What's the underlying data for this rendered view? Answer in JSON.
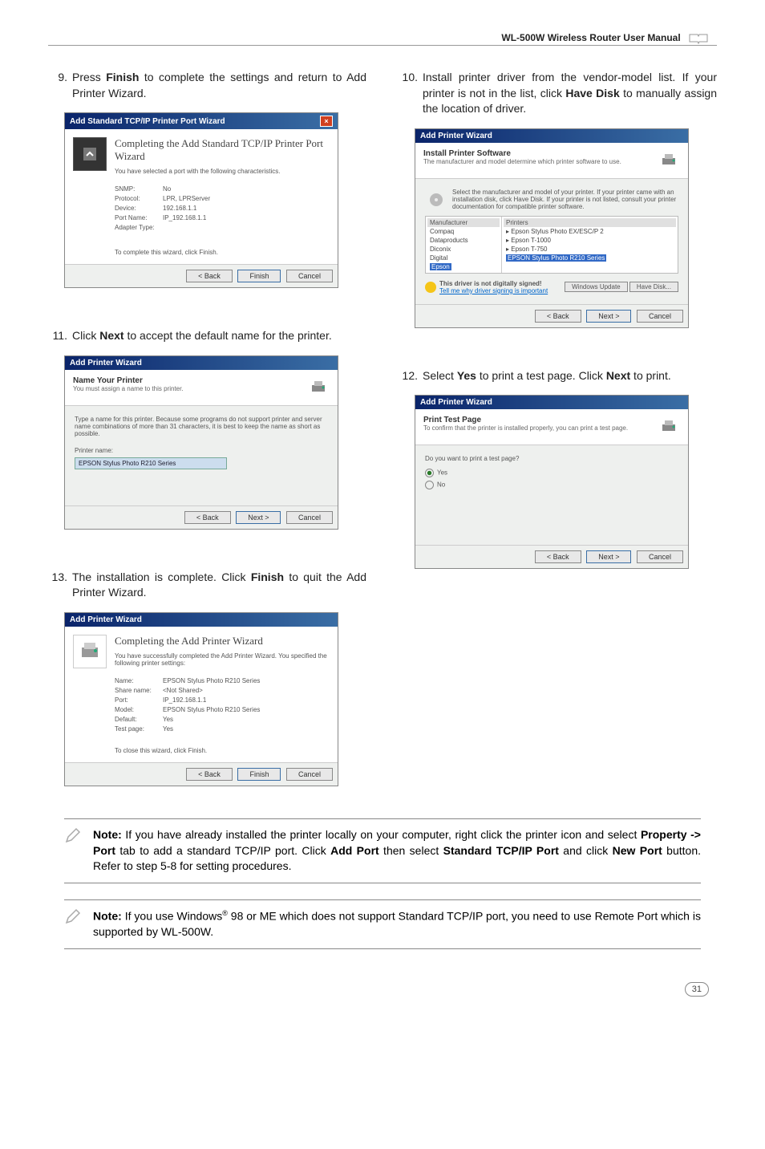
{
  "header": {
    "title": "WL-500W Wireless Router User Manual"
  },
  "steps": {
    "s9": {
      "num": "9.",
      "text_before": "Press ",
      "bold1": "Finish",
      "text_after": " to complete the settings and return to Add Printer Wizard."
    },
    "s10": {
      "num": "10.",
      "text_before": "Install printer driver from the vendor-model list. If your printer is not in the list, click ",
      "bold1": "Have Disk",
      "text_after": " to manually assign the location of driver."
    },
    "s11": {
      "num": "11.",
      "text_before": "Click ",
      "bold1": "Next",
      "text_after": " to accept the default name for the printer."
    },
    "s12": {
      "num": "12.",
      "text_before": "Select ",
      "bold1": "Yes",
      "text_mid": " to print a test page. Click ",
      "bold2": "Next",
      "text_after": " to print."
    },
    "s13": {
      "num": "13.",
      "text_before": "The installation is complete. Click ",
      "bold1": "Finish",
      "text_after": " to quit the Add Printer Wizard."
    }
  },
  "dialog9": {
    "title": "Add Standard TCP/IP Printer Port Wizard",
    "heading": "Completing the Add Standard TCP/IP Printer Port Wizard",
    "sub": "You have selected a port with the following characteristics.",
    "rows": {
      "snmp_l": "SNMP:",
      "snmp_v": "No",
      "proto_l": "Protocol:",
      "proto_v": "LPR, LPRServer",
      "dev_l": "Device:",
      "dev_v": "192.168.1.1",
      "port_l": "Port Name:",
      "port_v": "IP_192.168.1.1",
      "adapter_l": "Adapter Type:"
    },
    "footer_note": "To complete this wizard, click Finish.",
    "buttons": {
      "back": "< Back",
      "finish": "Finish",
      "cancel": "Cancel"
    }
  },
  "dialog10": {
    "title": "Add Printer Wizard",
    "heading": "Install Printer Software",
    "sub": "The manufacturer and model determine which printer software to use.",
    "instr": "Select the manufacturer and model of your printer. If your printer came with an installation disk, click Have Disk. If your printer is not listed, consult your printer documentation for compatible printer software.",
    "manu_hdr": "Manufacturer",
    "manu_items": [
      "Compaq",
      "Dataproducts",
      "Diconix",
      "Digital",
      "Epson"
    ],
    "printers_hdr": "Printers",
    "printers_items": [
      "Epson Stylus Photo EX/ESC/P 2",
      "Epson T-1000",
      "Epson T-750",
      "EPSON Stylus Photo R210 Series"
    ],
    "sig_text": "This driver is not digitally signed!",
    "sig_link": "Tell me why driver signing is important",
    "buttons": {
      "wu": "Windows Update",
      "hd": "Have Disk...",
      "back": "< Back",
      "next": "Next >",
      "cancel": "Cancel"
    }
  },
  "dialog11": {
    "title": "Add Printer Wizard",
    "heading": "Name Your Printer",
    "sub": "You must assign a name to this printer.",
    "instr": "Type a name for this printer. Because some programs do not support printer and server name combinations of more than 31 characters, it is best to keep the name as short as possible.",
    "label": "Printer name:",
    "value": "EPSON Stylus Photo R210 Series",
    "buttons": {
      "back": "< Back",
      "next": "Next >",
      "cancel": "Cancel"
    }
  },
  "dialog12": {
    "title": "Add Printer Wizard",
    "heading": "Print Test Page",
    "sub": "To confirm that the printer is installed properly, you can print a test page.",
    "question": "Do you want to print a test page?",
    "yes": "Yes",
    "no": "No",
    "buttons": {
      "back": "< Back",
      "next": "Next >",
      "cancel": "Cancel"
    }
  },
  "dialog13": {
    "title": "Add Printer Wizard",
    "heading": "Completing the Add Printer Wizard",
    "sub": "You have successfully completed the Add Printer Wizard. You specified the following printer settings:",
    "rows": {
      "name_l": "Name:",
      "name_v": "EPSON Stylus Photo R210 Series",
      "share_l": "Share name:",
      "share_v": "<Not Shared>",
      "port_l": "Port:",
      "port_v": "IP_192.168.1.1",
      "model_l": "Model:",
      "model_v": "EPSON Stylus Photo R210 Series",
      "def_l": "Default:",
      "def_v": "Yes",
      "test_l": "Test page:",
      "test_v": "Yes"
    },
    "footer_note": "To close this wizard, click Finish.",
    "buttons": {
      "back": "< Back",
      "finish": "Finish",
      "cancel": "Cancel"
    }
  },
  "notes": {
    "n1_pre": "Note:",
    "n1_text": " If you have already installed the printer locally on your computer, right click the printer icon and select ",
    "n1_b1": "Property -> Port",
    "n1_mid1": " tab to add a standard TCP/IP port. Click ",
    "n1_b2": "Add Port",
    "n1_mid2": " then select ",
    "n1_b3": "Standard TCP/IP Port",
    "n1_mid3": " and click ",
    "n1_b4": "New Port",
    "n1_end": " button. Refer to step 5-8 for setting procedures.",
    "n2_pre": "Note:",
    "n2_text1": " If you use Windows",
    "n2_sup": "®",
    "n2_text2": " 98 or ME which does not support Standard TCP/IP port, you need to use Remote Port which is supported by WL-500W."
  },
  "page_number": "31"
}
